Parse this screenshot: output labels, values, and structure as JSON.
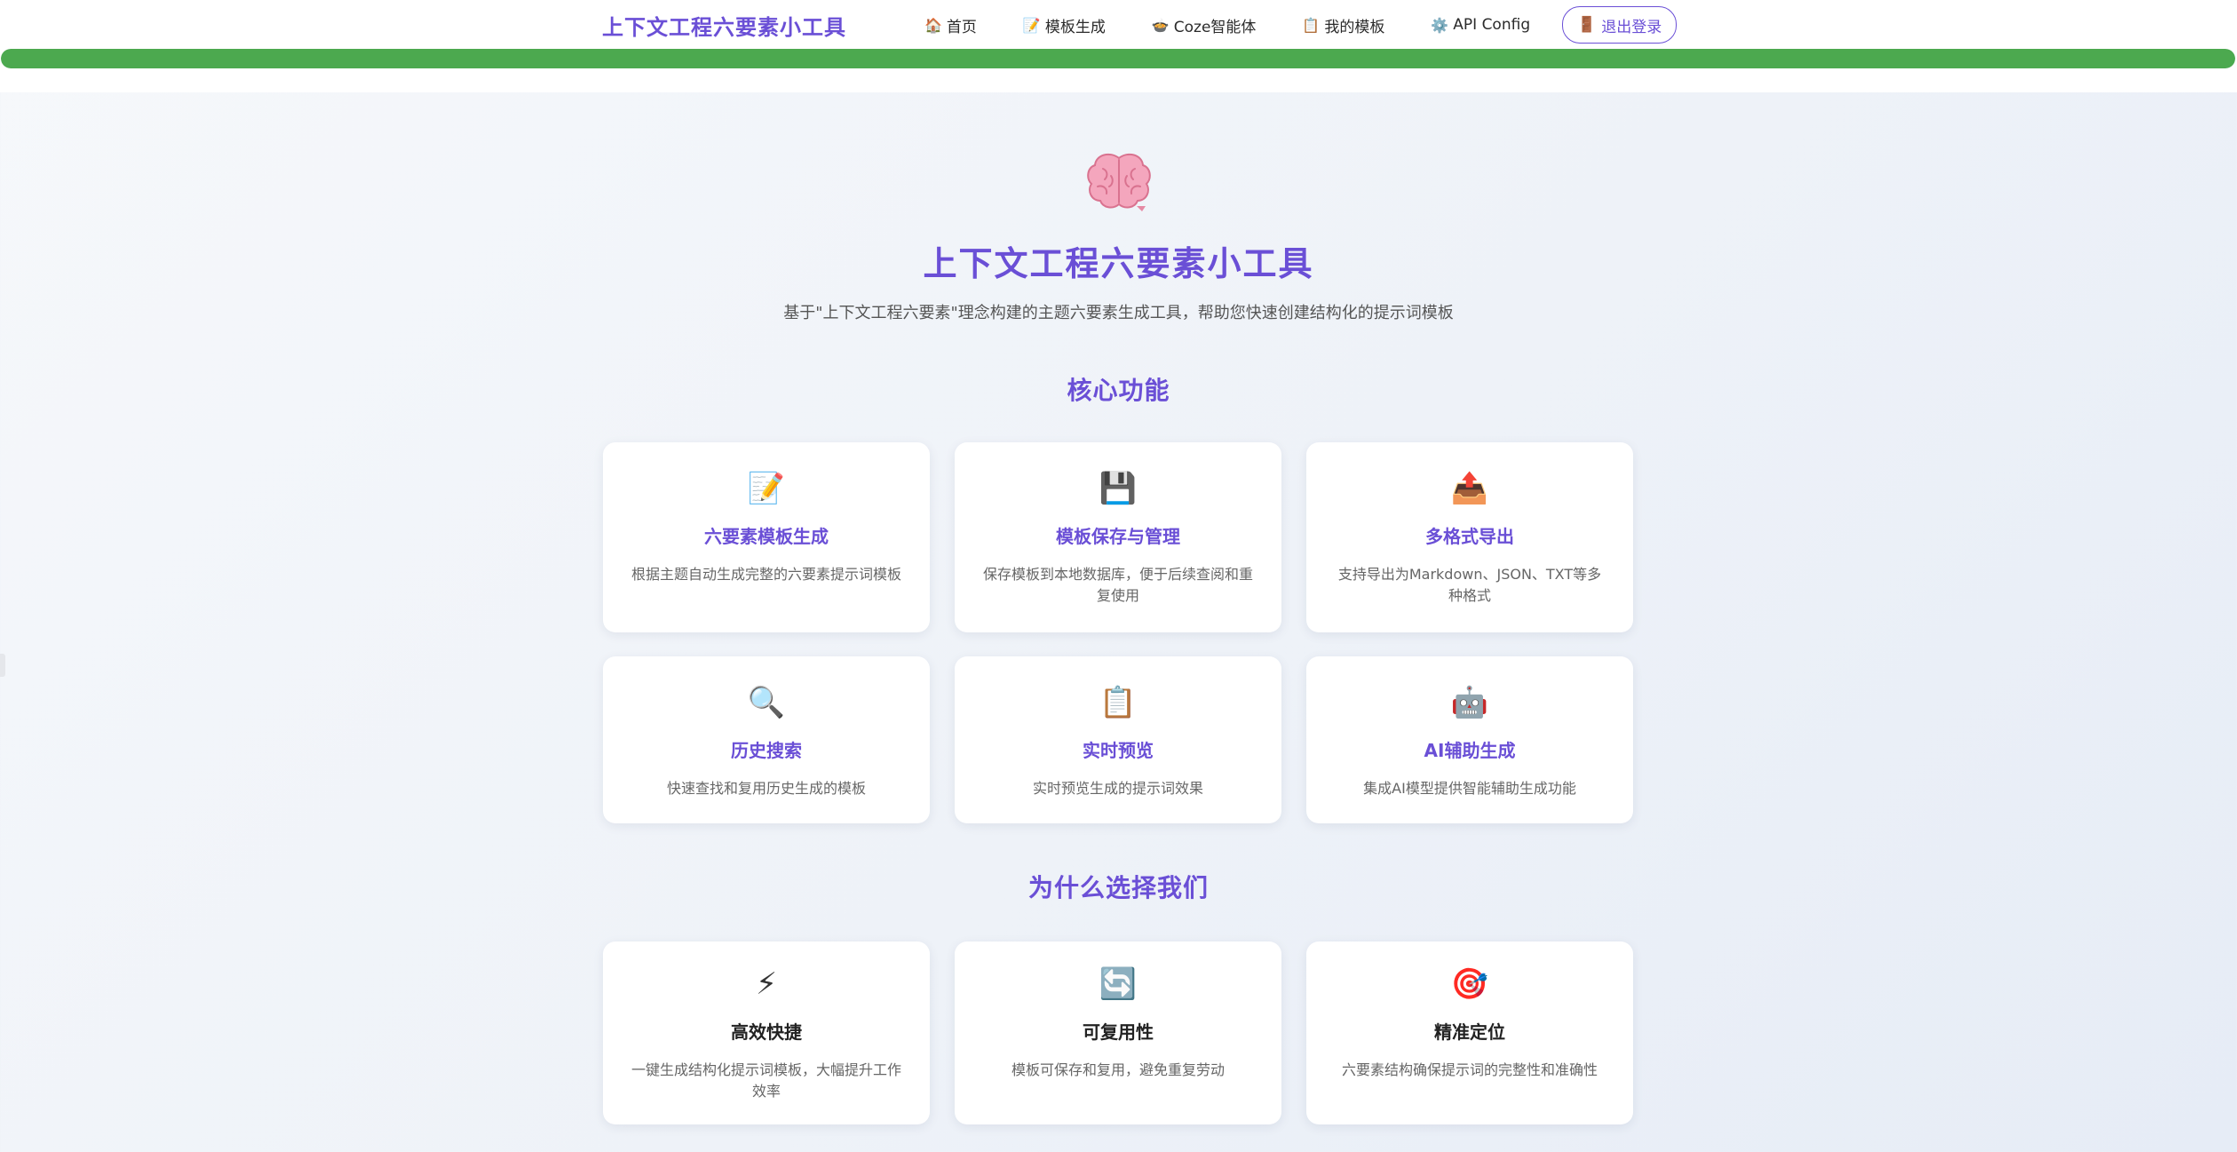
{
  "navbar": {
    "brand": "上下文工程六要素小工具",
    "links": [
      {
        "icon": "🏠",
        "icon_name": "home-icon",
        "label": "首页"
      },
      {
        "icon": "📝",
        "icon_name": "memo-icon",
        "label": "模板生成"
      },
      {
        "icon": "🍲",
        "icon_name": "pot-icon",
        "label": "Coze智能体"
      },
      {
        "icon": "📋",
        "icon_name": "notebook-icon",
        "label": "我的模板"
      },
      {
        "icon": "⚙️",
        "icon_name": "gear-icon",
        "label": "API Config"
      }
    ],
    "logout": {
      "icon": "🚪",
      "label": "退出登录"
    }
  },
  "progress": {
    "value": 1.0,
    "color": "#4ca94f"
  },
  "hero": {
    "icon": "🧠",
    "title": "上下文工程六要素小工具",
    "subtitle": "基于\"上下文工程六要素\"理念构建的主题六要素生成工具，帮助您快速创建结构化的提示词模板"
  },
  "features": {
    "heading": "核心功能",
    "items": [
      {
        "icon": "📝",
        "icon_name": "memo-icon",
        "title": "六要素模板生成",
        "desc": "根据主题自动生成完整的六要素提示词模板"
      },
      {
        "icon": "💾",
        "icon_name": "floppy-disk-icon",
        "title": "模板保存与管理",
        "desc": "保存模板到本地数据库，便于后续查阅和重复使用"
      },
      {
        "icon": "📤",
        "icon_name": "outbox-icon",
        "title": "多格式导出",
        "desc": "支持导出为Markdown、JSON、TXT等多种格式"
      },
      {
        "icon": "🔍",
        "icon_name": "magnifier-icon",
        "title": "历史搜索",
        "desc": "快速查找和复用历史生成的模板"
      },
      {
        "icon": "📋",
        "icon_name": "clipboard-icon",
        "title": "实时预览",
        "desc": "实时预览生成的提示词效果"
      },
      {
        "icon": "🤖",
        "icon_name": "robot-icon",
        "title": "AI辅助生成",
        "desc": "集成AI模型提供智能辅助生成功能"
      }
    ]
  },
  "why": {
    "heading": "为什么选择我们",
    "items": [
      {
        "icon": "⚡",
        "icon_name": "lightning-icon",
        "title": "高效快捷",
        "desc": "一键生成结构化提示词模板，大幅提升工作效率"
      },
      {
        "icon": "🔄",
        "icon_name": "refresh-icon",
        "title": "可复用性",
        "desc": "模板可保存和复用，避免重复劳动"
      },
      {
        "icon": "🎯",
        "icon_name": "target-icon",
        "title": "精准定位",
        "desc": "六要素结构确保提示词的完整性和准确性"
      }
    ]
  }
}
